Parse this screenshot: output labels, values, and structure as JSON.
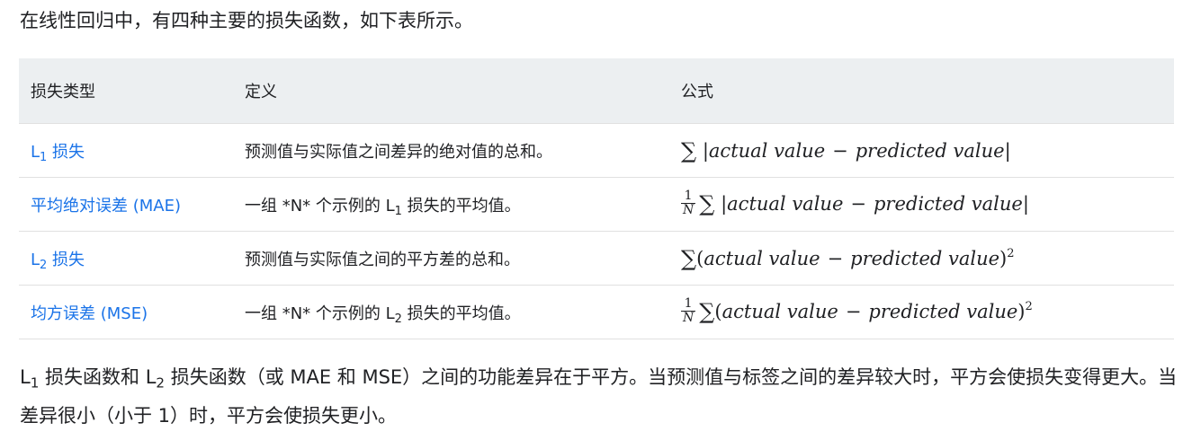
{
  "intro": "在线性回归中，有四种主要的损失函数，如下表所示。",
  "table": {
    "headers": {
      "type": "损失类型",
      "definition": "定义",
      "formula": "公式"
    },
    "rows": [
      {
        "type_prefix": "L",
        "type_sub": "1",
        "type_suffix": " 损失",
        "def_before": "预测值与实际值之间差异的绝对值的总和。",
        "def_sub": "",
        "def_after": "",
        "frac_num": "",
        "frac_den": "",
        "math_open": "|",
        "term_a": "actual value",
        "minus": "−",
        "term_b": "predicted value",
        "math_close": "|",
        "exponent": ""
      },
      {
        "type_prefix": "平均绝对误差 (MAE)",
        "type_sub": "",
        "type_suffix": "",
        "def_before": "一组 *N* 个示例的 L",
        "def_sub": "1",
        "def_after": " 损失的平均值。",
        "frac_num": "1",
        "frac_den": "N",
        "math_open": "|",
        "term_a": "actual value",
        "minus": "−",
        "term_b": "predicted value",
        "math_close": "|",
        "exponent": ""
      },
      {
        "type_prefix": "L",
        "type_sub": "2",
        "type_suffix": " 损失",
        "def_before": "预测值与实际值之间的平方差的总和。",
        "def_sub": "",
        "def_after": "",
        "frac_num": "",
        "frac_den": "",
        "math_open": "(",
        "term_a": "actual value",
        "minus": "−",
        "term_b": "predicted value",
        "math_close": ")",
        "exponent": "2"
      },
      {
        "type_prefix": "均方误差 (MSE)",
        "type_sub": "",
        "type_suffix": "",
        "def_before": "一组 *N* 个示例的 L",
        "def_sub": "2",
        "def_after": " 损失的平均值。",
        "frac_num": "1",
        "frac_den": "N",
        "math_open": "(",
        "term_a": "actual value",
        "minus": "−",
        "term_b": "predicted value",
        "math_close": ")",
        "exponent": "2"
      }
    ]
  },
  "sum_symbol": "∑",
  "outro": {
    "l1_letter": "L",
    "l1_sub": "1",
    "mid": " 损失函数和 ",
    "l2_letter": "L",
    "l2_sub": "2",
    "rest": " 损失函数（或 MAE 和 MSE）之间的功能差异在于平方。当预测值与标签之间的差异较大时，平方会使损失变得更大。当差异很小（小于 1）时，平方会使损失更小。"
  }
}
